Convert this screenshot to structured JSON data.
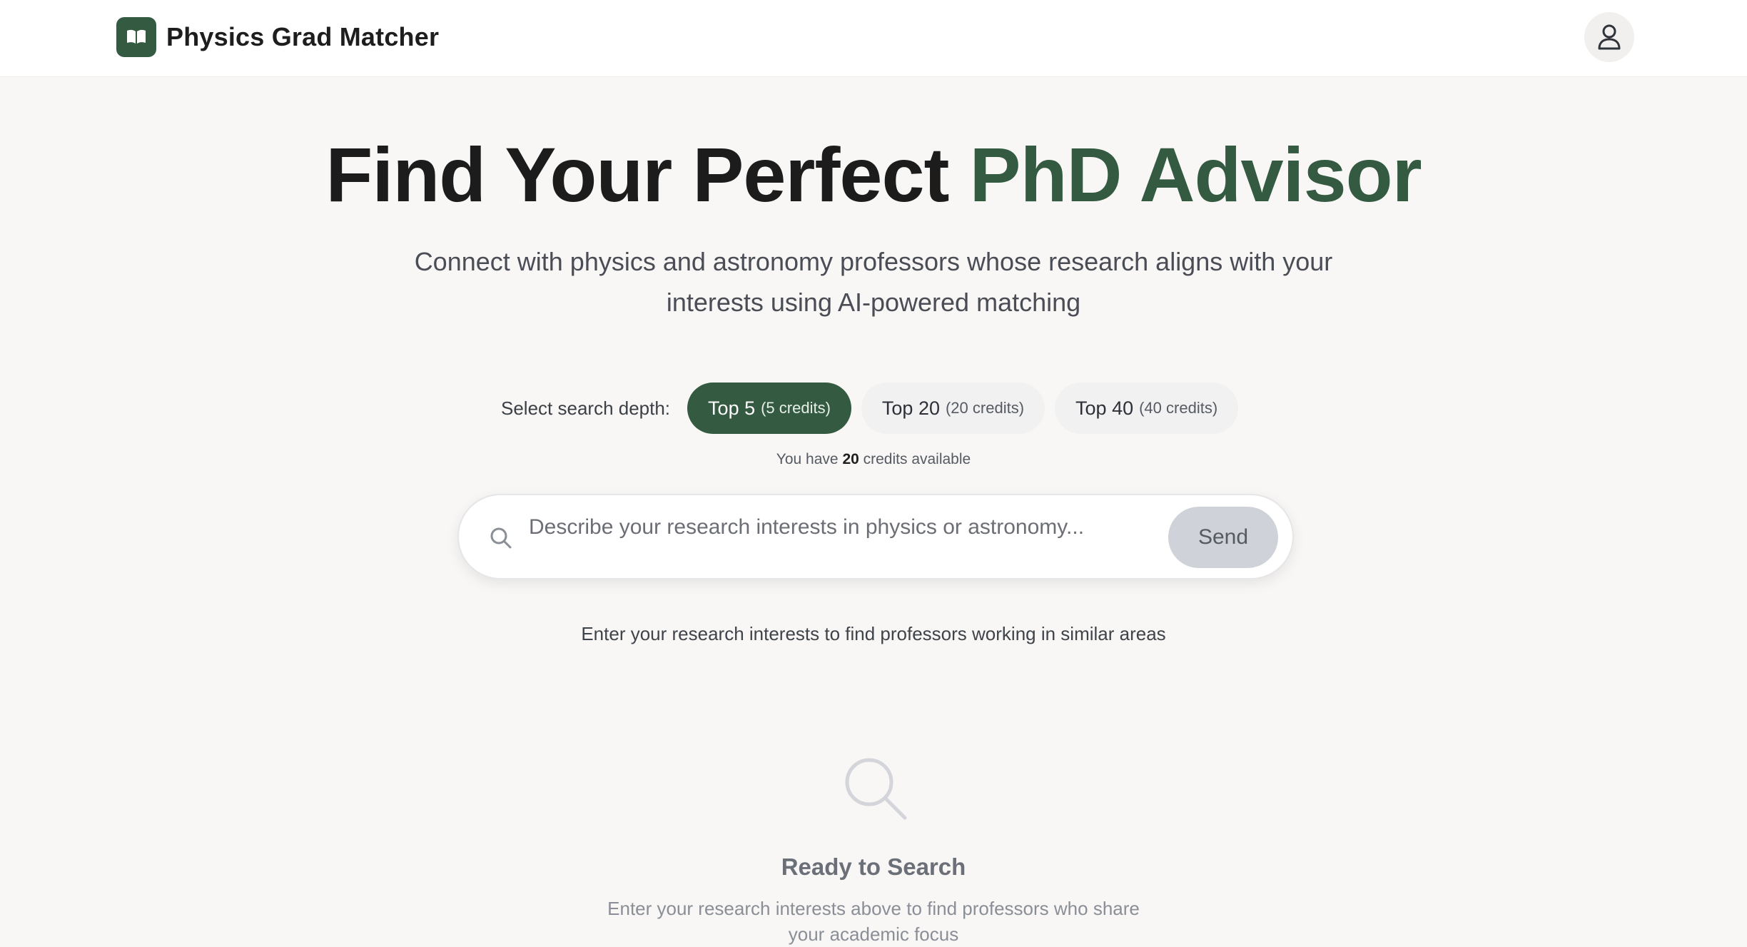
{
  "header": {
    "app_name": "Physics Grad Matcher",
    "logo_icon": "open-book-icon",
    "user_icon": "user-icon"
  },
  "hero": {
    "title_main": "Find Your Perfect ",
    "title_accent": "PhD Advisor",
    "subtitle": "Connect with physics and astronomy professors whose research aligns with your interests using AI-powered matching"
  },
  "depth": {
    "label": "Select search depth:",
    "selected": "Top 5",
    "options": [
      {
        "label": "Top 5",
        "credits": "(5 credits)"
      },
      {
        "label": "Top 20",
        "credits": "(20 credits)"
      },
      {
        "label": "Top 40",
        "credits": "(40 credits)"
      }
    ]
  },
  "credits_note": {
    "prefix": "You have ",
    "amount": "20",
    "suffix": " credits available"
  },
  "search": {
    "placeholder": "Describe your research interests in physics or astronomy...",
    "value": "",
    "send_label": "Send"
  },
  "hint": "Enter your research interests to find professors working in similar areas",
  "empty_state": {
    "icon": "search-icon",
    "title": "Ready to Search",
    "description": "Enter your research interests above to find professors who share your academic focus"
  },
  "colors": {
    "accent": "#345a42",
    "background": "#f8f7f5",
    "send_disabled": "#cfd2d8"
  }
}
